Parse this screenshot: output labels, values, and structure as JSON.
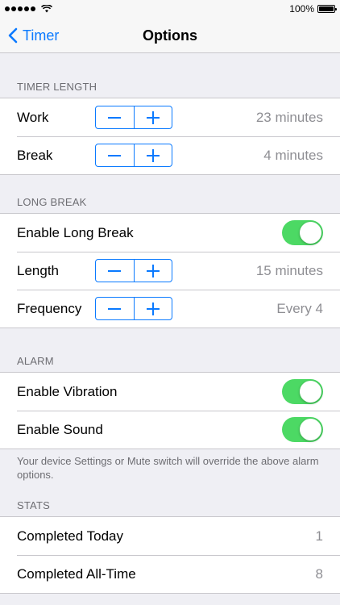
{
  "status_bar": {
    "battery": "100%"
  },
  "nav": {
    "back_label": "Timer",
    "title": "Options"
  },
  "timer_length": {
    "header": "TIMER LENGTH",
    "rows": [
      {
        "label": "Work",
        "value": "23 minutes"
      },
      {
        "label": "Break",
        "value": "4 minutes"
      }
    ]
  },
  "long_break": {
    "header": "LONG BREAK",
    "enable_label": "Enable Long Break",
    "enable_on": true,
    "length_label": "Length",
    "length_value": "15 minutes",
    "frequency_label": "Frequency",
    "frequency_value": "Every 4"
  },
  "alarm": {
    "header": "ALARM",
    "vibration_label": "Enable Vibration",
    "vibration_on": true,
    "sound_label": "Enable Sound",
    "sound_on": true,
    "footer": "Your device Settings or Mute switch will override the above alarm options."
  },
  "stats": {
    "header": "STATS",
    "today_label": "Completed Today",
    "today_value": "1",
    "alltime_label": "Completed All-Time",
    "alltime_value": "8"
  },
  "colors": {
    "accent": "#0a7aff",
    "toggle_on": "#4cd964",
    "background": "#efeff4"
  }
}
